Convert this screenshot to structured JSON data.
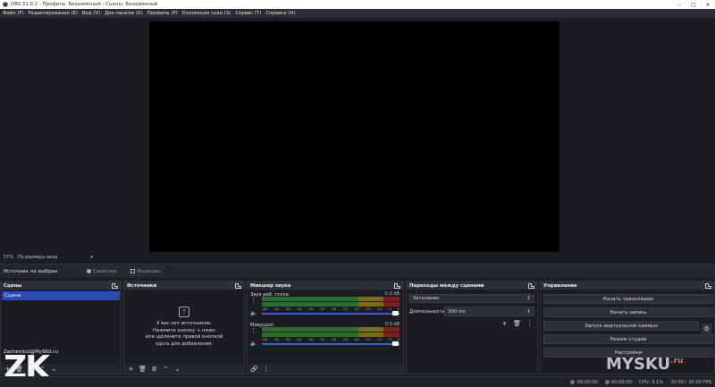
{
  "window": {
    "title": "OBS 31.0.2 - Профиль: Безымянный - Сцены: Безымянный"
  },
  "menu": [
    "Файл (F)",
    "Редактирование (E)",
    "Вид (V)",
    "Док-панели (D)",
    "Профиль (P)",
    "Коллекция сцен (S)",
    "Сервис (T)",
    "Справка (H)"
  ],
  "zoom": {
    "value": "57%",
    "mode": "По размеру окна"
  },
  "source_bar": {
    "label": "Источник не выбран",
    "properties": "Свойства",
    "filters": "Фильтры"
  },
  "scenes": {
    "title": "Сцены",
    "items": [
      "Сцена"
    ]
  },
  "sources": {
    "title": "Источники",
    "empty_line1": "У вас нет источников.",
    "empty_line2": "Нажмите кнопку + ниже",
    "empty_line3": "или щёлкните правой кнопкой",
    "empty_line4": "здесь для добавления."
  },
  "mixer": {
    "title": "Микшер звука",
    "channels": [
      {
        "name": "Звук раб. стола",
        "db": "0.0 dB"
      },
      {
        "name": "Микр/доп",
        "db": "0.0 dB"
      }
    ],
    "scale": [
      "-60",
      "-55",
      "-50",
      "-45",
      "-40",
      "-35",
      "-30",
      "-25",
      "-20",
      "-15",
      "-10",
      "-5",
      "0"
    ]
  },
  "transitions": {
    "title": "Переходы между сценами",
    "selected": "Затухание",
    "duration_label": "Длительность",
    "duration": "300 ms"
  },
  "controls": {
    "title": "Управление",
    "start_stream": "Начать трансляцию",
    "start_record": "Начать запись",
    "virtual_cam": "Запуск виртуальной камеры",
    "studio_mode": "Режим студии",
    "settings": "Настройки"
  },
  "status": {
    "stream_time": "00:00:00",
    "record_time": "00:00:00",
    "cpu": "CPU: 3.1%",
    "fps": "30.00 / 30.00 FPS"
  },
  "watermarks": {
    "email": "Zachemtut@MySKU.ru",
    "logo": "ZK",
    "site": "MYSKU",
    "tld": ".ru"
  }
}
